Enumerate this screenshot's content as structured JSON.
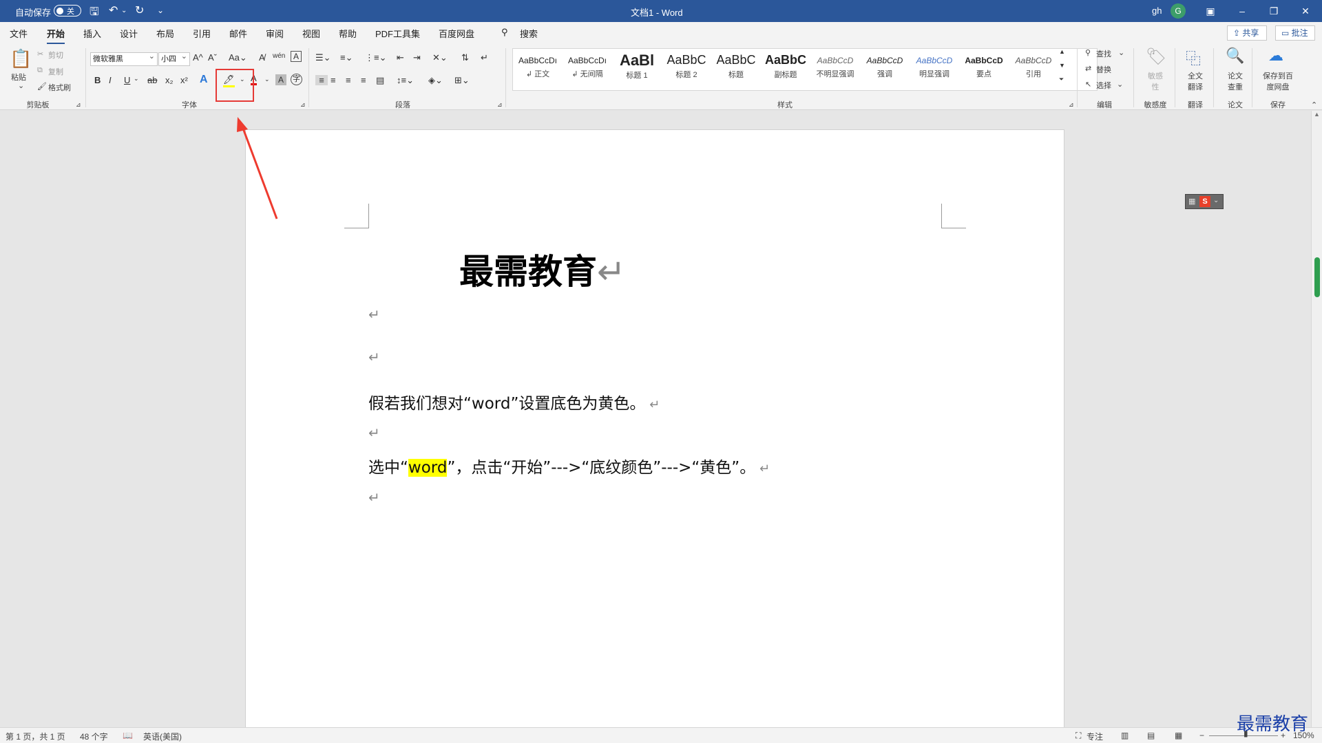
{
  "titlebar": {
    "autosave_label": "自动保存",
    "autosave_state": "关",
    "doc_title": "文档1  -  Word",
    "user": "gh",
    "avatar_letter": "G"
  },
  "menu": {
    "tabs": [
      "文件",
      "开始",
      "插入",
      "设计",
      "布局",
      "引用",
      "邮件",
      "审阅",
      "视图",
      "帮助",
      "PDF工具集",
      "百度网盘"
    ],
    "search": "搜索",
    "share": "共享",
    "comment": "批注"
  },
  "ribbon": {
    "clipboard": {
      "paste": "粘贴",
      "cut": "剪切",
      "copy": "复制",
      "format_painter": "格式刷",
      "label": "剪贴板"
    },
    "font": {
      "font_name": "微软雅黑",
      "font_size": "小四",
      "label": "字体"
    },
    "paragraph": {
      "label": "段落"
    },
    "styles": {
      "label": "样式",
      "items": [
        {
          "sample": "AaBbCcDı",
          "name": "↲ 正文"
        },
        {
          "sample": "AaBbCcDı",
          "name": "↲ 无间隔"
        },
        {
          "sample": "AaBl",
          "name": "标题 1"
        },
        {
          "sample": "AaBbC",
          "name": "标题 2"
        },
        {
          "sample": "AaBbC",
          "name": "标题"
        },
        {
          "sample": "AaBbC",
          "name": "副标题"
        },
        {
          "sample": "AaBbCcD",
          "name": "不明显强调"
        },
        {
          "sample": "AaBbCcD",
          "name": "强调"
        },
        {
          "sample": "AaBbCcD",
          "name": "明显强调"
        },
        {
          "sample": "AaBbCcD",
          "name": "要点"
        },
        {
          "sample": "AaBbCcD",
          "name": "引用"
        }
      ]
    },
    "editing": {
      "find": "查找",
      "replace": "替换",
      "select": "选择",
      "label": "编辑"
    },
    "sensitivity": {
      "button": "敏感性",
      "label": "敏感度"
    },
    "translate": {
      "button": "全文翻译",
      "label": "翻译"
    },
    "paper": {
      "button": "论文查重",
      "label": "论文"
    },
    "save": {
      "button": "保存到百度网盘",
      "label": "保存"
    }
  },
  "document": {
    "title": "最需教育",
    "line1": "假若我们想对“word”设置底色为黄色。",
    "line2_pre": "选中“",
    "line2_hl": "word",
    "line2_post": "”，点击“开始”--->“底纹颜色”--->“黄色”。"
  },
  "status": {
    "page": "第 1 页，共 1 页",
    "words": "48 个字",
    "language": "英语(美国)",
    "focus": "专注",
    "zoom": "150%"
  },
  "watermark": "最需教育",
  "colors": {
    "titlebar": "#2b579a",
    "highlight": "#ffff00",
    "annotation": "#e53935"
  }
}
